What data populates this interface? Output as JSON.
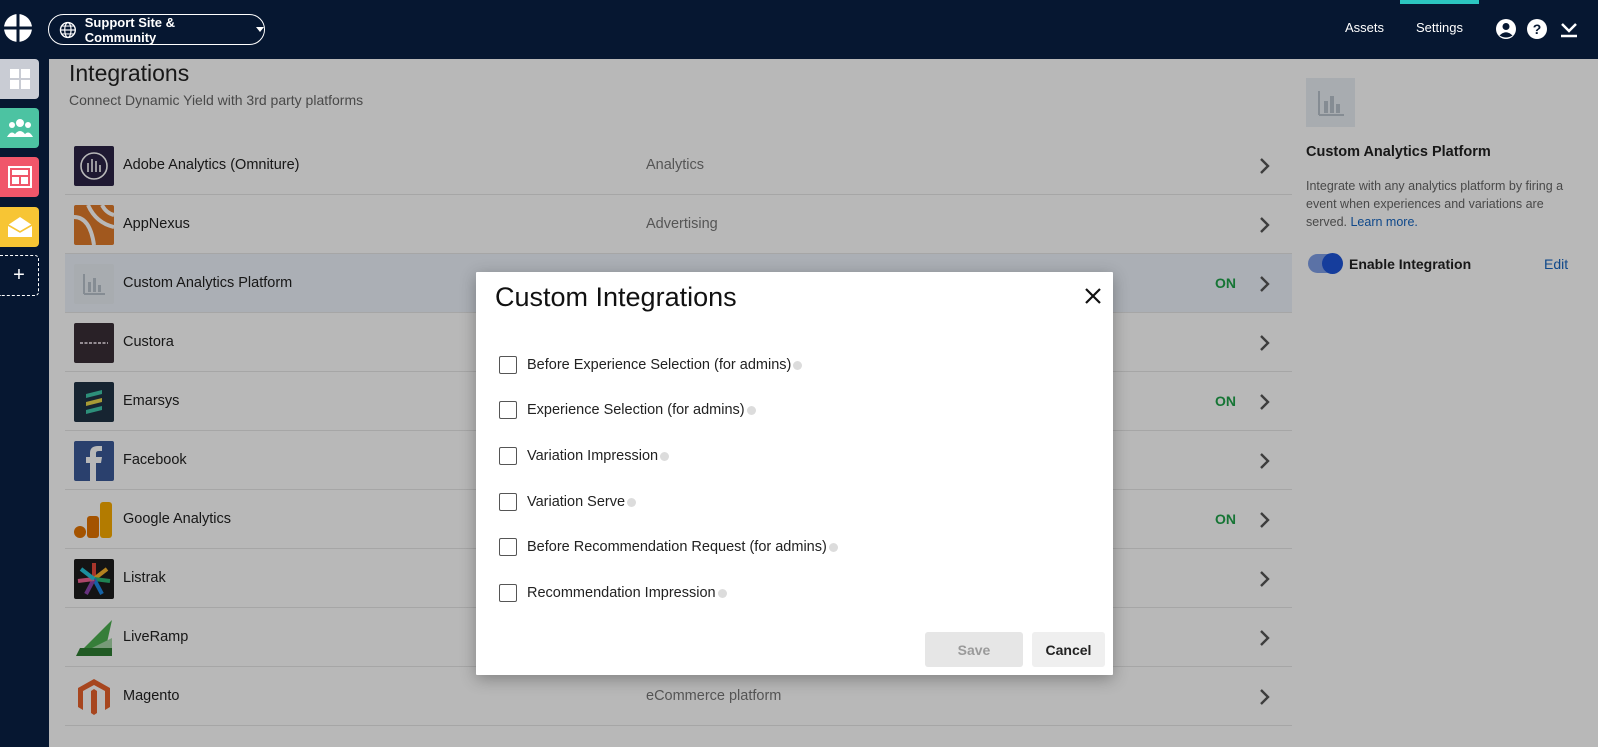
{
  "header": {
    "site_selector": "Support Site & Community",
    "nav": [
      "Assets",
      "Settings"
    ],
    "icons": [
      "account-icon",
      "help-icon",
      "download-icon"
    ]
  },
  "page": {
    "title": "Integrations",
    "subtitle": "Connect Dynamic Yield with 3rd party platforms"
  },
  "integrations": [
    {
      "name": "Adobe Analytics (Omniture)",
      "category": "Analytics",
      "status": ""
    },
    {
      "name": "AppNexus",
      "category": "Advertising",
      "status": ""
    },
    {
      "name": "Custom Analytics Platform",
      "category": "",
      "status": "ON"
    },
    {
      "name": "Custora",
      "category": "",
      "status": ""
    },
    {
      "name": "Emarsys",
      "category": "",
      "status": "ON"
    },
    {
      "name": "Facebook",
      "category": "",
      "status": ""
    },
    {
      "name": "Google Analytics",
      "category": "",
      "status": "ON"
    },
    {
      "name": "Listrak",
      "category": "",
      "status": ""
    },
    {
      "name": "LiveRamp",
      "category": "",
      "status": ""
    },
    {
      "name": "Magento",
      "category": "eCommerce platform",
      "status": ""
    }
  ],
  "detail_panel": {
    "title": "Custom Analytics Platform",
    "description": "Integrate with any analytics platform by firing a event when experiences and variations are served.",
    "learn_more": "Learn more.",
    "toggle_label": "Enable Integration",
    "edit_label": "Edit",
    "toggle_on": true
  },
  "modal": {
    "title": "Custom Integrations",
    "options": [
      "Before Experience Selection (for admins)",
      "Experience Selection (for admins)",
      "Variation Impression",
      "Variation Serve",
      "Before Recommendation Request (for admins)",
      "Recommendation Impression"
    ],
    "save_label": "Save",
    "cancel_label": "Cancel"
  },
  "colors": {
    "topbar": "#061731",
    "accent_active": "#2cc6c0",
    "status_on": "#1fa24a",
    "link": "#1565c0"
  }
}
